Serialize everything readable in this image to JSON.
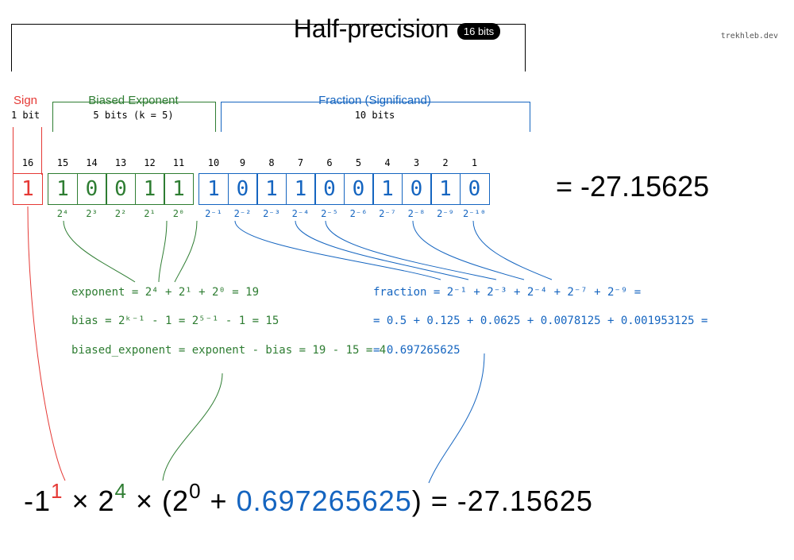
{
  "title": "Half-precision",
  "badge": "16 bits",
  "attribution": "trekhleb.dev",
  "sections": {
    "sign": {
      "label": "Sign",
      "sub": "1 bit"
    },
    "exp": {
      "label": "Biased Exponent",
      "sub": "5 bits (k = 5)"
    },
    "frac": {
      "label": "Fraction (Significand)",
      "sub": "10 bits"
    }
  },
  "indices": [
    "16",
    "15",
    "14",
    "13",
    "12",
    "11",
    "10",
    "9",
    "8",
    "7",
    "6",
    "5",
    "4",
    "3",
    "2",
    "1"
  ],
  "bits": {
    "sign": [
      "1"
    ],
    "exp": [
      "1",
      "0",
      "0",
      "1",
      "1"
    ],
    "frac": [
      "1",
      "0",
      "1",
      "1",
      "0",
      "0",
      "1",
      "0",
      "1",
      "0"
    ]
  },
  "powers": {
    "sign": [
      ""
    ],
    "exp": [
      "2⁴",
      "2³",
      "2²",
      "2¹",
      "2⁰"
    ],
    "frac": [
      "2⁻¹",
      "2⁻²",
      "2⁻³",
      "2⁻⁴",
      "2⁻⁵",
      "2⁻⁶",
      "2⁻⁷",
      "2⁻⁸",
      "2⁻⁹",
      "2⁻¹⁰"
    ]
  },
  "result_eq": "=  -27.15625",
  "exp_comp": {
    "l1": "exponent = 2⁴ + 2¹ + 2⁰ = 19",
    "l2": "bias = 2ᵏ⁻¹ - 1 = 2⁵⁻¹ - 1 = 15",
    "l3": "biased_exponent = exponent - bias = 19 - 15 = 4"
  },
  "frac_comp": {
    "l1": "fraction = 2⁻¹ + 2⁻³ + 2⁻⁴ + 2⁻⁷ + 2⁻⁹ =",
    "l2": "= 0.5 + 0.125 + 0.0625 + 0.0078125 + 0.001953125 =",
    "l3": "= 0.697265625"
  },
  "final": {
    "neg1": "-1",
    "sup1": "1",
    "times1": "  ×  2",
    "sup4": "4",
    "times2": "  ×  (2",
    "sup0": "0",
    "plus": " + ",
    "fracv": "0.697265625",
    "tail": ") = -27.15625"
  }
}
